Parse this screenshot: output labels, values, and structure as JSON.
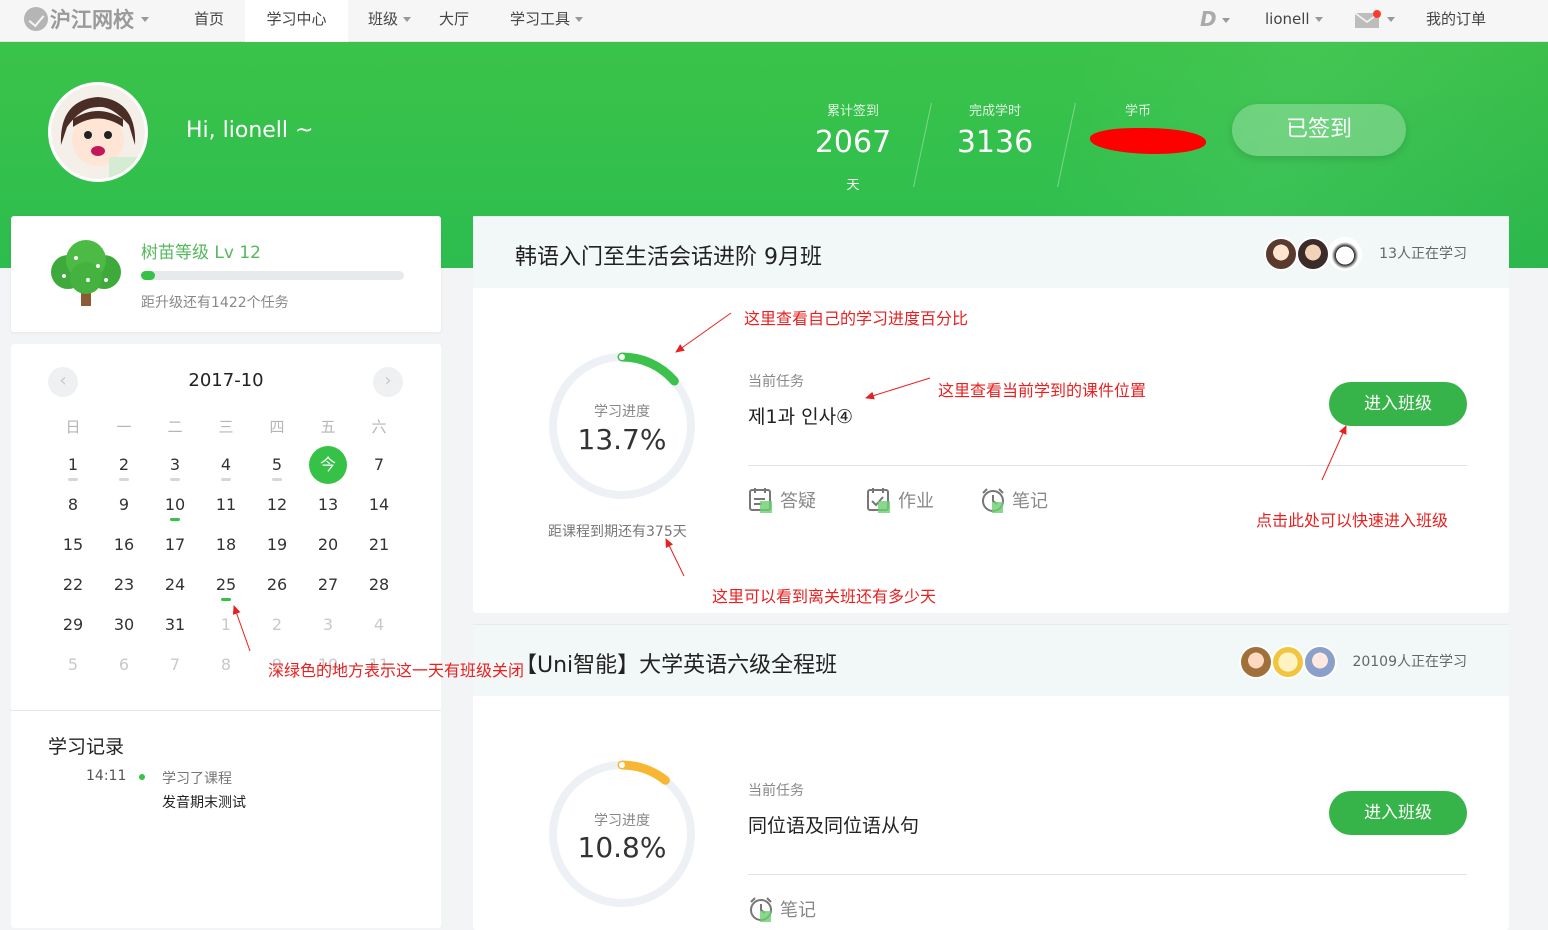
{
  "nav": {
    "logo": "沪江网校",
    "items": [
      "首页",
      "学习中心",
      "班级",
      "大厅",
      "学习工具"
    ],
    "d_label": "D",
    "username": "lionell",
    "orders": "我的订单"
  },
  "hero": {
    "greeting": "Hi, lionell ~",
    "stats": [
      {
        "label": "累计签到",
        "value": "2067",
        "unit": "天"
      },
      {
        "label": "完成学时",
        "value": "3136"
      },
      {
        "label": "学币"
      }
    ],
    "signed_button": "已签到"
  },
  "level": {
    "title": "树苗等级 Lv 12",
    "progress": 0.05,
    "subtitle": "距升级还有1422个任务"
  },
  "calendar": {
    "prev": "‹",
    "next": "›",
    "title": "2017-10",
    "weekdays": [
      "日",
      "一",
      "二",
      "三",
      "四",
      "五",
      "六"
    ],
    "today_label": "今",
    "rows": [
      [
        "1",
        "2",
        "3",
        "4",
        "5",
        "6",
        "7"
      ],
      [
        "8",
        "9",
        "10",
        "11",
        "12",
        "13",
        "14"
      ],
      [
        "15",
        "16",
        "17",
        "18",
        "19",
        "20",
        "21"
      ],
      [
        "22",
        "23",
        "24",
        "25",
        "26",
        "27",
        "28"
      ],
      [
        "29",
        "30",
        "31",
        "1",
        "2",
        "3",
        "4"
      ],
      [
        "5",
        "6",
        "7",
        "8",
        "9",
        "10",
        "11"
      ]
    ],
    "today": "6",
    "class_close_days": [
      "10",
      "25"
    ],
    "grey_dot_days": [
      "1",
      "2",
      "3",
      "4",
      "5"
    ],
    "accent": "#36c147",
    "grey_dot": "#d7d7d7"
  },
  "record": {
    "title": "学习记录",
    "time": "14:11",
    "action": "学习了课程",
    "course": "发音期末测试"
  },
  "classes": [
    {
      "title": "韩语入门至生活会话进阶 9月班",
      "learners": "13人正在学习",
      "progress_label": "学习进度",
      "progress": "13.7%",
      "progress_value": 0.137,
      "ring_color": "#3cc14c",
      "expire": "距课程到期还有375天",
      "task_label": "当前任务",
      "task": "제1과 인사④",
      "enter": "进入班级",
      "tools": [
        "答疑",
        "作业",
        "笔记"
      ]
    },
    {
      "title": "【Uni智能】大学英语六级全程班",
      "learners": "20109人正在学习",
      "progress_label": "学习进度",
      "progress": "10.8%",
      "progress_value": 0.108,
      "ring_color": "#f7b733",
      "task_label": "当前任务",
      "task": "同位语及同位语从句",
      "enter": "进入班级",
      "tools": [
        "笔记"
      ]
    }
  ],
  "annotations": {
    "progress": "这里查看自己的学习进度百分比",
    "task": "这里查看当前学到的课件位置",
    "enter": "点击此处可以快速进入班级",
    "expire": "这里可以看到离关班还有多少天",
    "calendar": "深绿色的地方表示这一天有班级关闭",
    "color": "#e82020"
  }
}
